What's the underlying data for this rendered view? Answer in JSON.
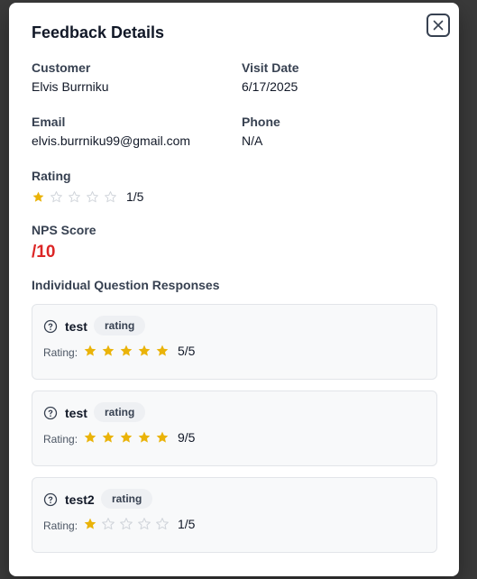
{
  "dialog": {
    "title": "Feedback Details",
    "close_icon": "close-icon"
  },
  "fields": {
    "customer_label": "Customer",
    "customer_value": "Elvis Burrniku",
    "visit_date_label": "Visit Date",
    "visit_date_value": "6/17/2025",
    "email_label": "Email",
    "email_value": "elvis.burrniku99@gmail.com",
    "phone_label": "Phone",
    "phone_value": "N/A",
    "rating_label": "Rating",
    "rating_value": 1,
    "rating_max": 5,
    "rating_text": "1/5",
    "nps_label": "NPS Score",
    "nps_text": "/10"
  },
  "responses": {
    "title": "Individual Question Responses",
    "rating_label": "Rating:",
    "items": [
      {
        "question": "test",
        "type": "rating",
        "stars": 5,
        "value_text": "5/5"
      },
      {
        "question": "test",
        "type": "rating",
        "stars": 5,
        "value_text": "9/5"
      },
      {
        "question": "test2",
        "type": "rating",
        "stars": 1,
        "value_text": "1/5"
      }
    ]
  },
  "colors": {
    "star_filled": "#eab308",
    "star_empty": "#d1d5db",
    "nps": "#dc2626"
  }
}
